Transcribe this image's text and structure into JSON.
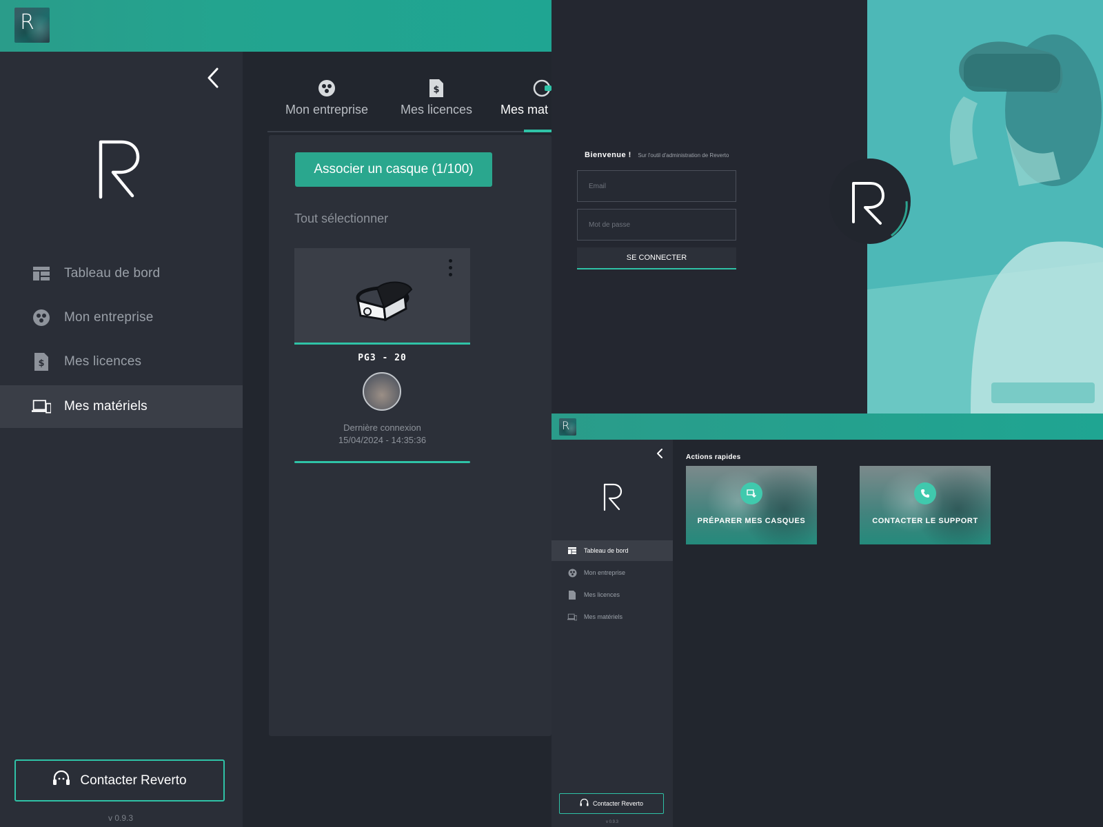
{
  "dashboard_large": {
    "sidebar": {
      "collapse_icon": "chevron-left-icon",
      "items": [
        {
          "label": "Tableau de bord",
          "icon": "dashboard-icon"
        },
        {
          "label": "Mon entreprise",
          "icon": "company-icon"
        },
        {
          "label": "Mes licences",
          "icon": "license-icon"
        },
        {
          "label": "Mes matériels",
          "icon": "devices-icon",
          "active": true
        }
      ],
      "contact_label": "Contacter Reverto",
      "version": "v 0.9.3"
    },
    "tabs": [
      {
        "label": "Mon entreprise",
        "icon": "company-icon"
      },
      {
        "label": "Mes licences",
        "icon": "license-icon"
      },
      {
        "label": "Mes mat",
        "icon": "headset-icon",
        "active": true
      }
    ],
    "associate_button": "Associer un casque (1/100)",
    "select_all": "Tout sélectionner",
    "device": {
      "name": "PG3 - 20",
      "last_connection_label": "Dernière connexion",
      "last_connection_value": "15/04/2024 - 14:35:36"
    }
  },
  "login": {
    "welcome_title": "Bienvenue !",
    "welcome_subtitle": "Sur l'outil d'administration de Reverto",
    "email_placeholder": "Email",
    "password_placeholder": "Mot de passe",
    "submit_label": "SE CONNECTER"
  },
  "dashboard_small": {
    "sidebar": {
      "items": [
        {
          "label": "Tableau de bord",
          "icon": "dashboard-icon",
          "active": true
        },
        {
          "label": "Mon entreprise",
          "icon": "company-icon"
        },
        {
          "label": "Mes licences",
          "icon": "license-icon"
        },
        {
          "label": "Mes matériels",
          "icon": "devices-icon"
        }
      ],
      "contact_label": "Contacter Reverto",
      "version": "v 0.9.3"
    },
    "quick_actions_title": "Actions rapides",
    "quick_actions": [
      {
        "label": "PRÉPARER MES CASQUES",
        "icon": "download-icon"
      },
      {
        "label": "CONTACTER LE SUPPORT",
        "icon": "phone-icon"
      }
    ]
  },
  "colors": {
    "accent": "#2fc3a7",
    "topbar": "#23a48f",
    "sidebar_bg": "#2a2e37",
    "content_bg": "#22262e"
  }
}
